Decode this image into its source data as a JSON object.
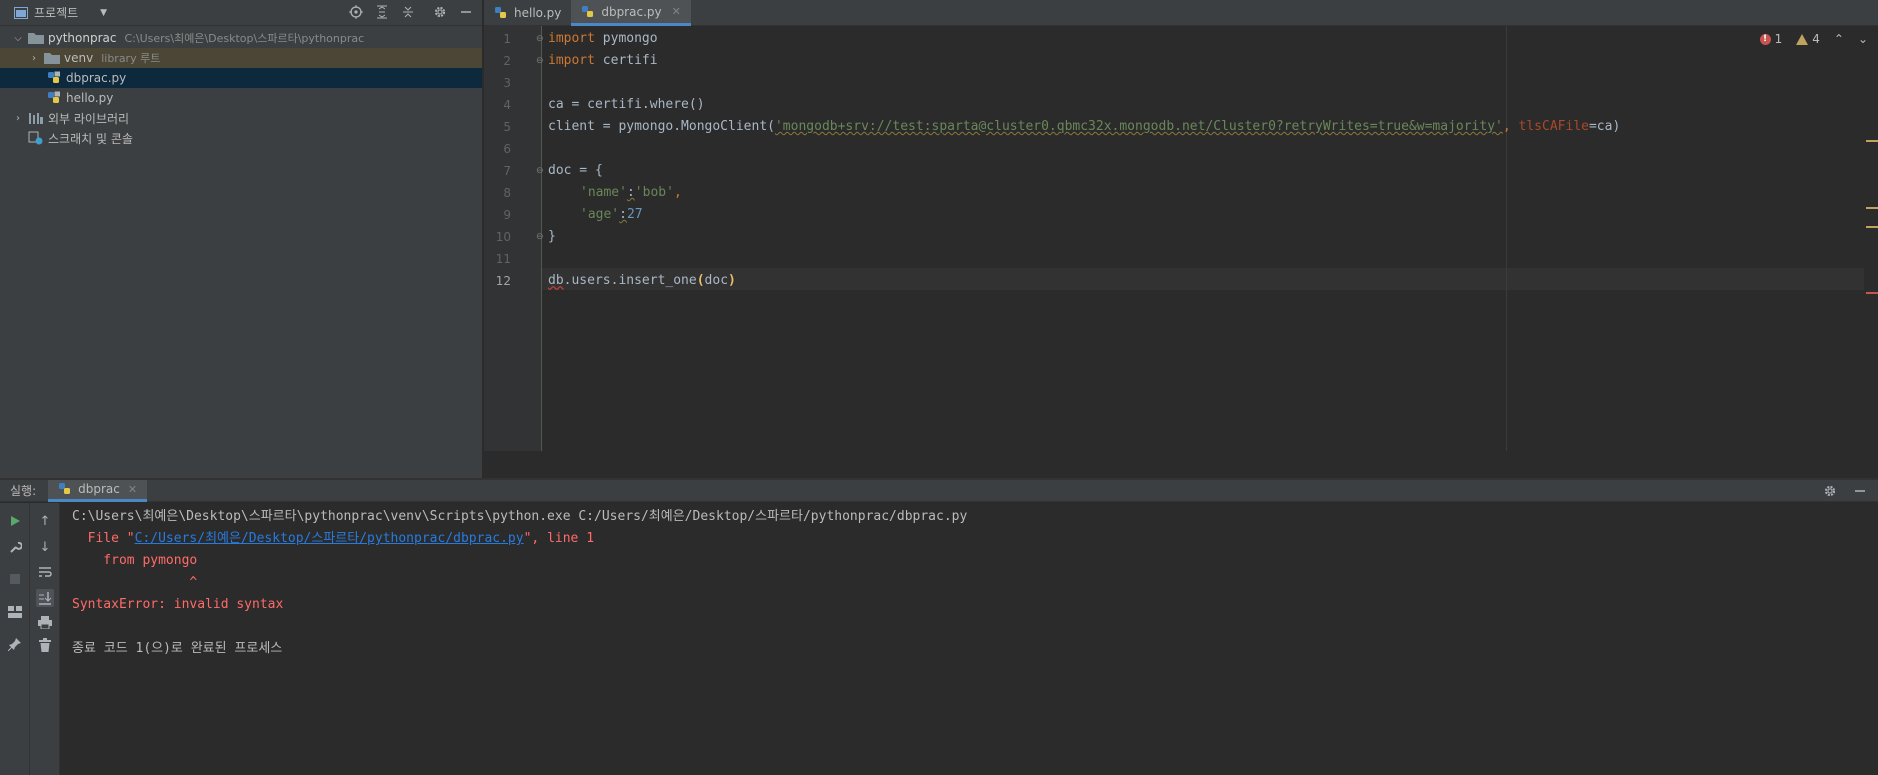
{
  "project_panel": {
    "title": "프로젝트",
    "tree": {
      "root_name": "pythonprac",
      "root_path": "C:\\Users\\최예은\\Desktop\\스파르타\\pythonprac",
      "venv_name": "venv",
      "venv_note": "library 루트",
      "files": [
        "dbprac.py",
        "hello.py"
      ],
      "external_libs": "외부 라이브러리",
      "scratches": "스크래치 및 콘솔"
    }
  },
  "editor": {
    "tabs": [
      {
        "label": "hello.py",
        "active": false
      },
      {
        "label": "dbprac.py",
        "active": true
      }
    ],
    "line_numbers": [
      "1",
      "2",
      "3",
      "4",
      "5",
      "6",
      "7",
      "8",
      "9",
      "10",
      "11",
      "12"
    ],
    "current_line": 12,
    "code": {
      "l1_kw": "import",
      "l1_rest": " pymongo",
      "l2_kw": "import",
      "l2_rest": " certifi",
      "l4": "ca = certifi.where()",
      "l5_pre": "client = pymongo.MongoClient(",
      "l5_str": "'mongodb+srv://test:sparta@cluster0.qbmc32x.mongodb.net/Cluster0?retryWrites=true&w=majority'",
      "l5_mid": ", ",
      "l5_param": "tlsCAFile",
      "l5_post": "=ca)",
      "l7": "doc = {",
      "l8_key": "'name'",
      "l8_sep": ":",
      "l8_val": "'bob'",
      "l8_end": ",",
      "l9_key": "'age'",
      "l9_sep": ":",
      "l9_val": "27",
      "l10": "}",
      "l12_db": "db",
      "l12_mid": ".users.insert_one",
      "l12_open": "(",
      "l12_arg": "doc",
      "l12_close": ")"
    },
    "inspections": {
      "errors": "1",
      "warnings": "4"
    }
  },
  "run_panel": {
    "label": "실행:",
    "tab": "dbprac",
    "output": {
      "cmd": "C:\\Users\\최예은\\Desktop\\스파르타\\pythonprac\\venv\\Scripts\\python.exe C:/Users/최예은/Desktop/스파르타/pythonprac/dbprac.py",
      "file_prefix": "  File \"",
      "file_link": "C:/Users/최예은/Desktop/스파르타/pythonprac/dbprac.py",
      "file_suffix": "\", line 1",
      "source_line": "    from pymongo",
      "caret": "               ^",
      "error": "SyntaxError: invalid syntax",
      "exit": "종료 코드 1(으)로 완료된 프로세스"
    }
  },
  "colors": {
    "accent": "#4a88c7",
    "error": "#ff6b68",
    "keyword": "#cc7832",
    "string": "#6a8759",
    "number": "#6897bb"
  }
}
